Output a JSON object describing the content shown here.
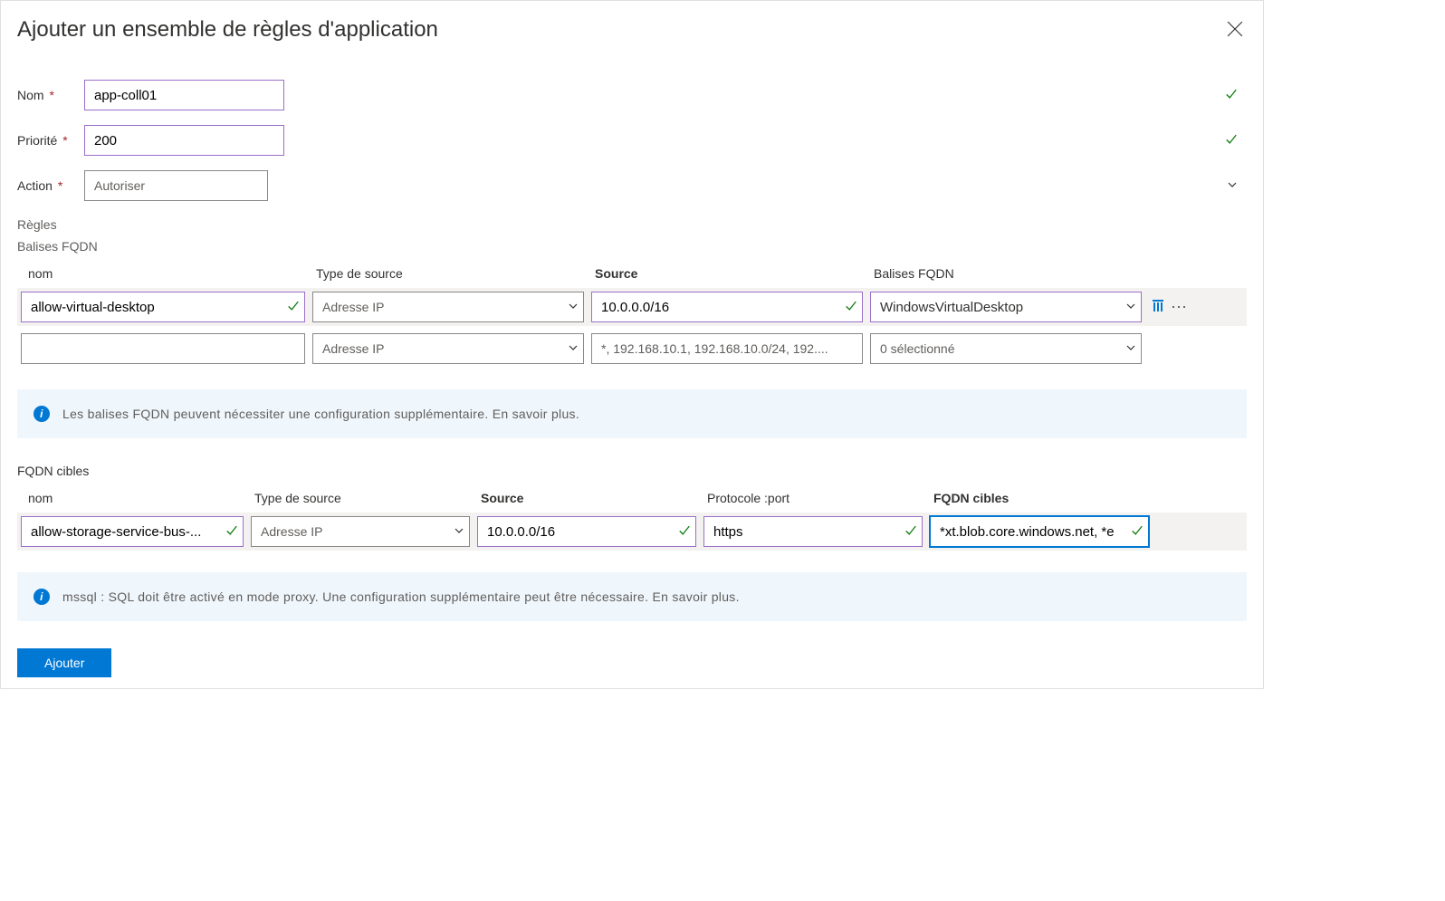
{
  "header": {
    "title": "Ajouter un ensemble de règles d'application"
  },
  "form": {
    "name_label": "Nom",
    "name_value": "app-coll01",
    "priority_label": "Priorité",
    "priority_value": "200",
    "action_label": "Action",
    "action_placeholder": "Autoriser"
  },
  "sections": {
    "rules": "Règles",
    "fqdn_tags": "Balises FQDN",
    "fqdn_targets": "FQDN cibles"
  },
  "tags_grid": {
    "headers": {
      "name": "nom",
      "source_type": "Type de source",
      "source": "Source",
      "tags": "Balises FQDN"
    },
    "rows": [
      {
        "name": "allow-virtual-desktop",
        "source_type": "Adresse IP",
        "source": "10.0.0.0/16",
        "tags": "WindowsVirtualDesktop",
        "validated": true
      },
      {
        "name": "",
        "source_type": "Adresse IP",
        "source_placeholder": "*, 192.168.10.1, 192.168.10.0/24, 192....",
        "tags": "0 sélectionné",
        "validated": false
      }
    ]
  },
  "info1": "Les balises FQDN peuvent nécessiter une configuration supplémentaire. En savoir plus.",
  "targets_grid": {
    "headers": {
      "name": "nom",
      "source_type": "Type de source",
      "source": "Source",
      "protocol": "Protocole :port",
      "fqdn": "FQDN cibles"
    },
    "row": {
      "name": "allow-storage-service-bus-...",
      "source_type": "Adresse IP",
      "source": "10.0.0.0/16",
      "protocol": "https",
      "fqdn": "*xt.blob.core.windows.net, *e"
    }
  },
  "info2": "mssql : SQL doit être activé en mode proxy. Une configuration supplémentaire peut être nécessaire. En savoir plus.",
  "footer": {
    "add": "Ajouter"
  }
}
